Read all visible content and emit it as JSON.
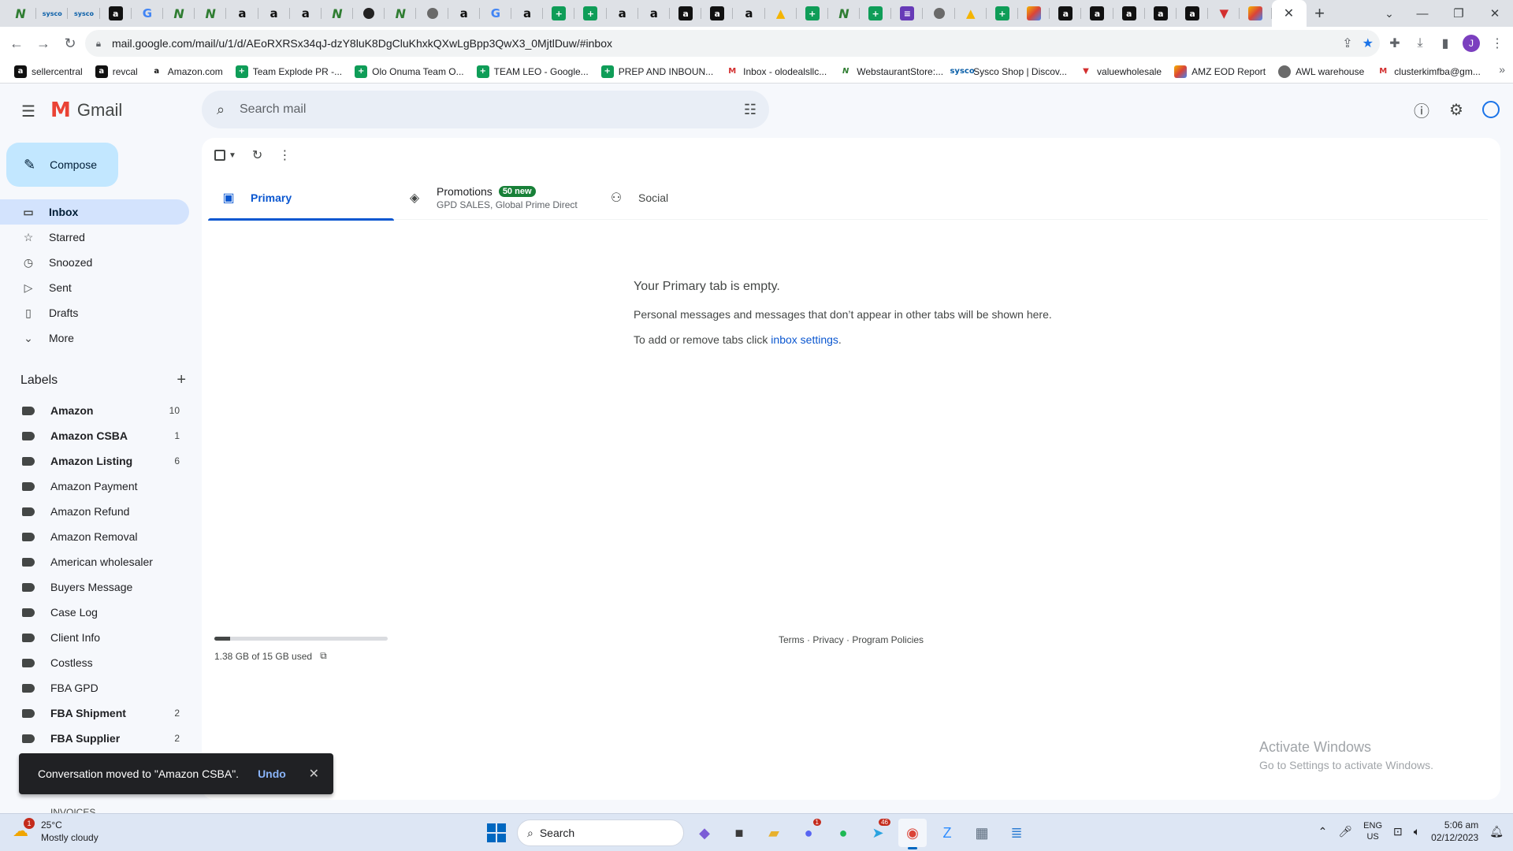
{
  "browser": {
    "url": "mail.google.com/mail/u/1/d/AEoRXRSx34qJ-dzY8luK8DgCluKhxkQXwLgBpp3QwX3_0MjtlDuw/#inbox",
    "profile_initial": "J",
    "pinned_tabs": [
      "sky",
      "sysco",
      "sysco",
      "amz",
      "goog",
      "sky",
      "sky",
      "amzl",
      "amzl",
      "amzl",
      "sky",
      "circle",
      "sky",
      "gray",
      "amzl",
      "goog",
      "amzl",
      "sheet",
      "sheet",
      "amzl",
      "amzl",
      "amz",
      "amz",
      "amzl",
      "drive",
      "sheet",
      "sky",
      "sheet",
      "form",
      "gray",
      "drive",
      "sheet",
      "multi",
      "amz",
      "amz",
      "amz",
      "amz",
      "amz",
      "red",
      "multi"
    ],
    "bookmarks": [
      {
        "label": "sellercentral",
        "icon": "amz"
      },
      {
        "label": "revcal",
        "icon": "amz"
      },
      {
        "label": "Amazon.com",
        "icon": "amzl"
      },
      {
        "label": "Team Explode PR -...",
        "icon": "sheet"
      },
      {
        "label": "Olo Onuma Team O...",
        "icon": "sheet"
      },
      {
        "label": "TEAM LEO - Google...",
        "icon": "sheet"
      },
      {
        "label": "PREP AND INBOUN...",
        "icon": "sheet"
      },
      {
        "label": "Inbox - olodealsllc...",
        "icon": "gmail"
      },
      {
        "label": "WebstaurantStore:...",
        "icon": "sky"
      },
      {
        "label": "Sysco Shop | Discov...",
        "icon": "sysco"
      },
      {
        "label": "valuewholesale",
        "icon": "red"
      },
      {
        "label": "AMZ EOD Report",
        "icon": "multi"
      },
      {
        "label": "AWL warehouse",
        "icon": "gray"
      },
      {
        "label": "clusterkimfba@gm...",
        "icon": "gmail"
      }
    ]
  },
  "gmail": {
    "logo_text": "Gmail",
    "search_placeholder": "Search mail",
    "compose_label": "Compose",
    "nav": [
      {
        "label": "Inbox",
        "icon": "inbox-icon",
        "glyph": "▭",
        "active": true
      },
      {
        "label": "Starred",
        "icon": "star-icon",
        "glyph": "☆",
        "active": false
      },
      {
        "label": "Snoozed",
        "icon": "clock-icon",
        "glyph": "◷",
        "active": false
      },
      {
        "label": "Sent",
        "icon": "send-icon",
        "glyph": "▷",
        "active": false
      },
      {
        "label": "Drafts",
        "icon": "draft-icon",
        "glyph": "▯",
        "active": false
      },
      {
        "label": "More",
        "icon": "chevron-down-icon",
        "glyph": "⌄",
        "active": false
      }
    ],
    "labels_title": "Labels",
    "labels": [
      {
        "name": "Amazon",
        "count": "10",
        "bold": true
      },
      {
        "name": "Amazon CSBA",
        "count": "1",
        "bold": true
      },
      {
        "name": "Amazon Listing",
        "count": "6",
        "bold": true
      },
      {
        "name": "Amazon Payment",
        "count": "",
        "bold": false
      },
      {
        "name": "Amazon Refund",
        "count": "",
        "bold": false
      },
      {
        "name": "Amazon Removal",
        "count": "",
        "bold": false
      },
      {
        "name": "American wholesaler",
        "count": "",
        "bold": false
      },
      {
        "name": "Buyers Message",
        "count": "",
        "bold": false
      },
      {
        "name": "Case Log",
        "count": "",
        "bold": false
      },
      {
        "name": "Client Info",
        "count": "",
        "bold": false
      },
      {
        "name": "Costless",
        "count": "",
        "bold": false
      },
      {
        "name": "FBA GPD",
        "count": "",
        "bold": false
      },
      {
        "name": "FBA Shipment",
        "count": "2",
        "bold": true
      },
      {
        "name": "FBA Supplier",
        "count": "2",
        "bold": true
      }
    ],
    "peek_label": "INVOICES",
    "tabs": {
      "primary": "Primary",
      "promotions": "Promotions",
      "promotions_badge": "50 new",
      "promotions_senders": "GPD SALES, Global Prime Direct",
      "social": "Social"
    },
    "empty": {
      "title": "Your Primary tab is empty.",
      "line1": "Personal messages and messages that don’t appear in other tabs will be shown here.",
      "line2_prefix": "To add or remove tabs click ",
      "line2_link": "inbox settings",
      "line2_suffix": "."
    },
    "storage": {
      "text": "1.38 GB of 15 GB used",
      "fraction": 0.092
    },
    "footer": "Terms · Privacy · Program Policies",
    "snackbar": {
      "message": "Conversation moved to \"Amazon CSBA\".",
      "action": "Undo"
    }
  },
  "watermark": {
    "line1": "Activate Windows",
    "line2": "Go to Settings to activate Windows."
  },
  "taskbar": {
    "weather_temp": "25°C",
    "weather_desc": "Mostly cloudy",
    "weather_badge": "1",
    "search_label": "Search",
    "apps": [
      {
        "name": "copilot-app",
        "glyph": "◆",
        "color": "#7b5cd6",
        "badge": ""
      },
      {
        "name": "file-manager-app",
        "glyph": "■",
        "color": "#3a3a3a",
        "badge": ""
      },
      {
        "name": "folder-app",
        "glyph": "▰",
        "color": "#e8b12d",
        "badge": ""
      },
      {
        "name": "discord-app",
        "glyph": "●",
        "color": "#5865f2",
        "badge": "1"
      },
      {
        "name": "spotify-app",
        "glyph": "●",
        "color": "#1db954",
        "badge": ""
      },
      {
        "name": "telegram-app",
        "glyph": "➤",
        "color": "#2aa3e0",
        "badge": "46"
      },
      {
        "name": "chrome-app",
        "glyph": "◉",
        "color": "#db4437",
        "badge": "",
        "active": true
      },
      {
        "name": "zoom-app",
        "glyph": "Z",
        "color": "#2d8cff",
        "badge": ""
      },
      {
        "name": "calculator-app",
        "glyph": "▦",
        "color": "#5b6b7c",
        "badge": ""
      },
      {
        "name": "notepad-app",
        "glyph": "≣",
        "color": "#2d7dd2",
        "badge": ""
      }
    ],
    "lang_1": "ENG",
    "lang_2": "US",
    "time": "5:06 am",
    "date": "02/12/2023"
  }
}
